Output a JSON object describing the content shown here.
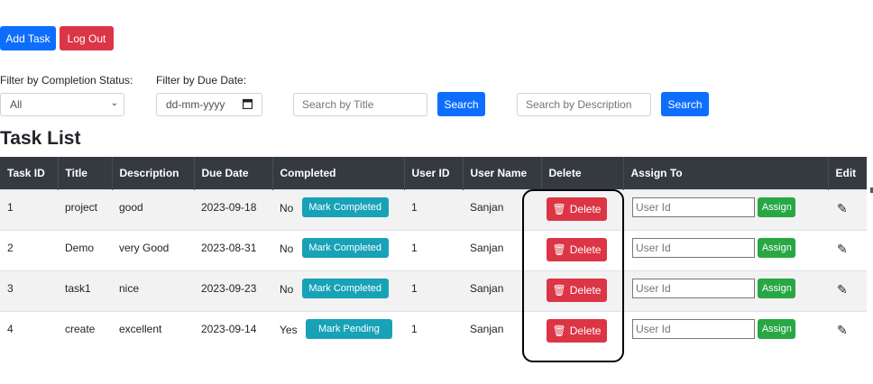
{
  "toolbar": {
    "add_task": "Add Task",
    "log_out": "Log Out"
  },
  "filters": {
    "completion_label": "Filter by Completion Status:",
    "completion_value": "All",
    "due_label": "Filter by Due Date:",
    "due_placeholder": "dd-mm-yyyy",
    "title_placeholder": "Search by Title",
    "title_search": "Search",
    "desc_placeholder": "Search by Description",
    "desc_search": "Search"
  },
  "heading": "Task List",
  "table": {
    "headers": [
      "Task ID",
      "Title",
      "Description",
      "Due Date",
      "Completed",
      "User ID",
      "User Name",
      "Delete",
      "Assign To",
      "Edit"
    ],
    "rows": [
      {
        "id": "1",
        "title": "project",
        "description": "good",
        "due": "2023-09-18",
        "completed": "No",
        "toggle": "Mark Completed",
        "user_id": "1",
        "user_name": "Sanjan",
        "delete": "Delete",
        "assign_placeholder": "User Id",
        "assign": "Assign"
      },
      {
        "id": "2",
        "title": "Demo",
        "description": "very Good",
        "due": "2023-08-31",
        "completed": "No",
        "toggle": "Mark Completed",
        "user_id": "1",
        "user_name": "Sanjan",
        "delete": "Delete",
        "assign_placeholder": "User Id",
        "assign": "Assign"
      },
      {
        "id": "3",
        "title": "task1",
        "description": "nice",
        "due": "2023-09-23",
        "completed": "No",
        "toggle": "Mark Completed",
        "user_id": "1",
        "user_name": "Sanjan",
        "delete": "Delete",
        "assign_placeholder": "User Id",
        "assign": "Assign"
      },
      {
        "id": "4",
        "title": "create",
        "description": "excellent",
        "due": "2023-09-14",
        "completed": "Yes",
        "toggle": "Mark Pending",
        "user_id": "1",
        "user_name": "Sanjan",
        "delete": "Delete",
        "assign_placeholder": "User Id",
        "assign": "Assign"
      }
    ]
  },
  "colors": {
    "primary": "#0d6efd",
    "danger": "#dc3545",
    "info": "#17a2b8",
    "success": "#28a745",
    "header_bg": "#343a40"
  },
  "icons": {
    "delete": "trash-icon",
    "edit": "pencil-icon",
    "calendar": "calendar-icon",
    "dropdown": "chevron-down-icon"
  }
}
